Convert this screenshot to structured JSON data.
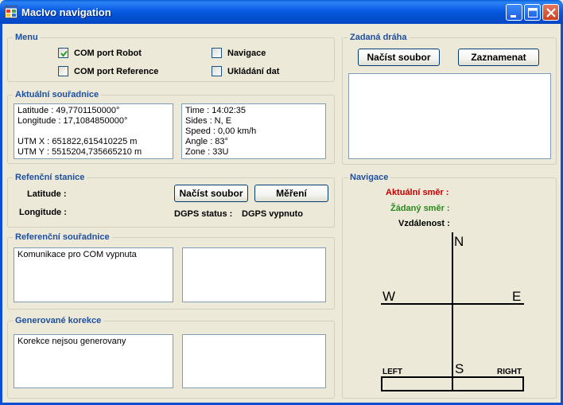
{
  "window": {
    "title": "MacIvo navigation"
  },
  "menu": {
    "title": "Menu",
    "com_robot": {
      "label": "COM port Robot",
      "checked": true
    },
    "com_reference": {
      "label": "COM port Reference",
      "checked": false
    },
    "navigace": {
      "label": "Navigace",
      "checked": false
    },
    "ukladani": {
      "label": "Ukládání dat",
      "checked": false
    }
  },
  "aktualni": {
    "title": "Aktuální souřadnice",
    "left_lines": [
      "Latitude : 49,7701150000°",
      "Longitude : 17,1084850000°",
      "",
      "UTM X : 651822,615410225 m",
      "UTM Y : 5515204,735665210 m"
    ],
    "right_lines": [
      "Time : 14:02:35",
      "Sides : N, E",
      "Speed : 0,00 km/h",
      "Angle : 83°",
      "Zone : 33U"
    ]
  },
  "referencni_stanice": {
    "title": "Refenční stanice",
    "latitude_label": "Latitude :",
    "longitude_label": "Longitude :",
    "load_button": "Načíst soubor",
    "measure_button": "Měření",
    "dgps_label": "DGPS status :",
    "dgps_value": "DGPS vypnuto"
  },
  "referencni_souradnice": {
    "title": "Referenční souřadnice",
    "left_text": "Komunikace pro COM vypnuta",
    "right_text": ""
  },
  "korekce": {
    "title": "Generované korekce",
    "left_text": "Korekce nejsou generovany",
    "right_text": ""
  },
  "zadana_draha": {
    "title": "Zadaná dráha",
    "load_button": "Načíst soubor",
    "record_button": "Zaznamenat",
    "text": ""
  },
  "navigace": {
    "title": "Navigace",
    "current_dir_label": "Aktuální směr :",
    "target_dir_label": "Žádaný směr :",
    "distance_label": "Vzdálenost :",
    "compass": {
      "n": "N",
      "s": "S",
      "w": "W",
      "e": "E"
    },
    "left_label": "LEFT",
    "right_label": "RIGHT"
  },
  "colors": {
    "titlebar": "#0a5ae3",
    "group_title": "#1e4f9e",
    "current_dir": "#c00000",
    "target_dir": "#2a8a1a"
  }
}
